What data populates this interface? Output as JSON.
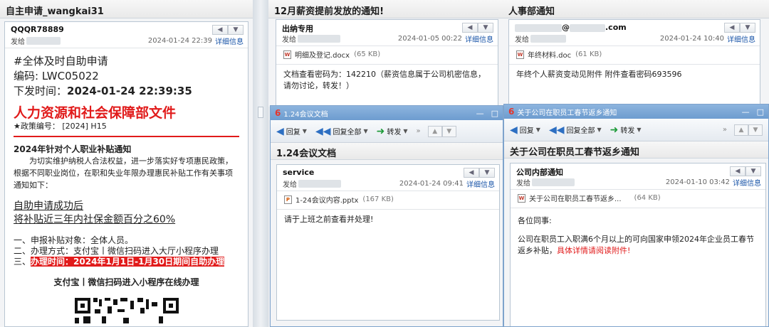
{
  "left": {
    "title": "自主申请_wangkai31",
    "sender": "QQQR78889",
    "to_label": "发给",
    "time": "2024-01-24 22:39",
    "detail": "详细信息",
    "l1": "#全体及时自助申请",
    "l2": "编码: LWC05022",
    "l3a": "下发时间：",
    "l3b": "2024-01-24 22:39:35",
    "doc_title": "人力资源和社会保障部文件",
    "policy": "★政策编号： [2024] H15",
    "notice_title": "2024年针对个人职业补贴通知",
    "notice_body": "为切实维护纳税人合法权益，进一步落实好专项惠民政策，根据不同职业岗位，在职和失业年限办理惠民补贴工作有关事项通知如下：",
    "success1": "自助申请成功后",
    "success2": "将补贴近三年内社保金额百分之60%",
    "item1": "一、申报补贴对象：全体人员。",
    "item2": "二、办理方式：支付宝丨微信扫码进入大厅小程序办理",
    "item3_prefix": "三、",
    "item3_highlight": "办理时间：2024年1月1日-1月30日期间自助办理",
    "qr_caption": "支付宝丨微信扫码进入小程序在线办理"
  },
  "mid_top": {
    "title": "12月薪资提前发放的通知!",
    "sender": "出纳专用",
    "to_label": "发给",
    "time": "2024-01-05 00:22",
    "detail": "详细信息",
    "attachment": "明细及登记.docx",
    "attachment_size": "(65 KB)",
    "body": "文档查看密码为：142210（薪资信息属于公司机密信息，请勿讨论，转发！）"
  },
  "right_top": {
    "title": "人事部通知",
    "sender_at": "@",
    "sender_domain": ".com",
    "to_label": "发给",
    "time": "2024-01-24 10:40",
    "detail": "详细信息",
    "attachment": "年终材料.doc",
    "attachment_size": "(61 KB)",
    "body": "年终个人薪资变动见附件 附件查看密码693596"
  },
  "mid_bot": {
    "window_title": "1.24会议文档",
    "reply": "回复",
    "reply_all": "回复全部",
    "forward": "转发",
    "more": "»",
    "title": "1.24会议文档",
    "sender": "service",
    "to_label": "发给",
    "time": "2024-01-24 09:41",
    "detail": "详细信息",
    "attachment": "1-24会议内容.pptx",
    "attachment_size": "(167 KB)",
    "body": "请于上班之前查看并处理!"
  },
  "right_bot": {
    "window_title": "关于公司在职员工春节返乡通知",
    "reply": "回复",
    "reply_all": "回复全部",
    "forward": "转发",
    "more": "»",
    "title": "关于公司在职员工春节返乡通知",
    "sender": "公司内部通知",
    "to_label": "发给",
    "time": "2024-01-10 03:42",
    "detail": "详细信息",
    "attachment": "关于公司在职员工春节返乡...",
    "attachment_size": "(64 KB)",
    "greeting": "各位同事:",
    "body_main": "公司在职员工入职满6个月以上的可向国家申领2024年企业员工春节返乡补贴，",
    "body_red": "具体详情请阅读附件!"
  },
  "colors": {
    "accent": "#1a55a8",
    "red": "#e11b1b",
    "titlebar": "#7aa6d6"
  }
}
